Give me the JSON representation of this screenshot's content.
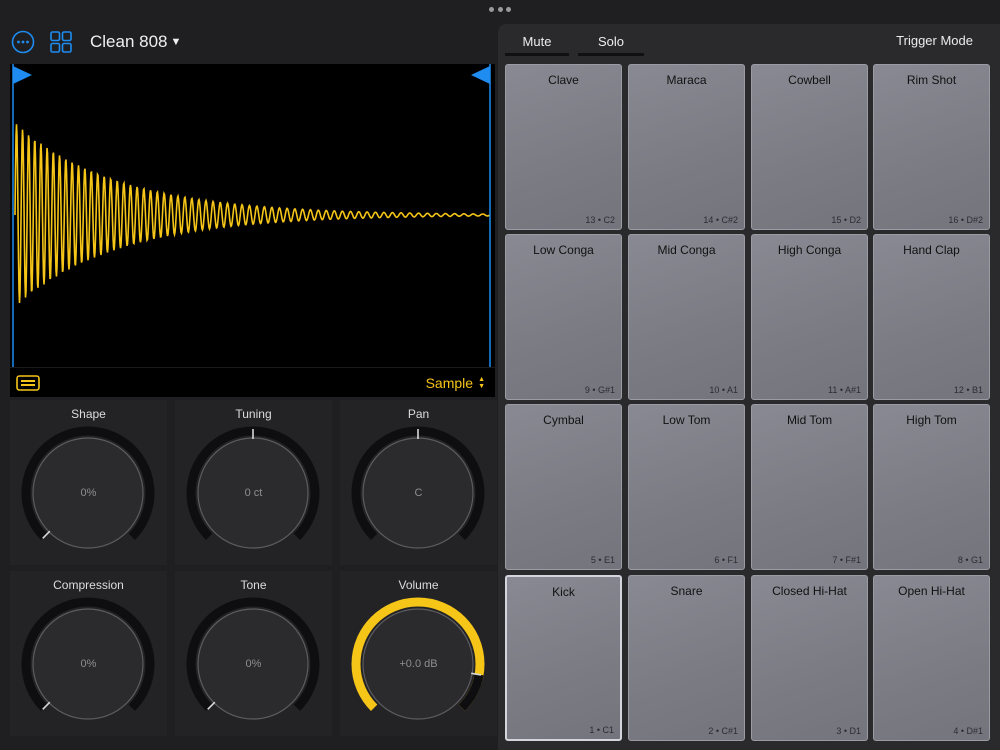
{
  "header": {
    "kit_name": "Clean 808"
  },
  "sampler": {
    "mode_label": "Sample",
    "wave_color": "#f5c518",
    "marker_color": "#1e8cf0"
  },
  "knobs": [
    {
      "label": "Shape",
      "value": "0%",
      "level": 0.0
    },
    {
      "label": "Tuning",
      "value": "0 ct",
      "level": 0.5
    },
    {
      "label": "Pan",
      "value": "C",
      "level": 0.5
    },
    {
      "label": "Compression",
      "value": "0%",
      "level": 0.0
    },
    {
      "label": "Tone",
      "value": "0%",
      "level": 0.0
    },
    {
      "label": "Volume",
      "value": "+0.0 dB",
      "level": 0.87
    }
  ],
  "tabs": {
    "mute": "Mute",
    "solo": "Solo",
    "trigger_mode": "Trigger Mode"
  },
  "pads": [
    {
      "name": "Clave",
      "note": "13 • C2"
    },
    {
      "name": "Maraca",
      "note": "14 • C#2"
    },
    {
      "name": "Cowbell",
      "note": "15 • D2"
    },
    {
      "name": "Rim Shot",
      "note": "16 • D#2"
    },
    {
      "name": "Low Conga",
      "note": "9 • G#1"
    },
    {
      "name": "Mid Conga",
      "note": "10 • A1"
    },
    {
      "name": "High Conga",
      "note": "11 • A#1"
    },
    {
      "name": "Hand Clap",
      "note": "12 • B1"
    },
    {
      "name": "Cymbal",
      "note": "5 • E1"
    },
    {
      "name": "Low Tom",
      "note": "6 • F1"
    },
    {
      "name": "Mid Tom",
      "note": "7 • F#1"
    },
    {
      "name": "High Tom",
      "note": "8 • G1"
    },
    {
      "name": "Kick",
      "note": "1 • C1",
      "selected": true
    },
    {
      "name": "Snare",
      "note": "2 • C#1"
    },
    {
      "name": "Closed Hi-Hat",
      "note": "3 • D1"
    },
    {
      "name": "Open Hi-Hat",
      "note": "4 • D#1"
    }
  ],
  "colors": {
    "accent": "#1e8cf0",
    "volume_ring": "#f5c518"
  }
}
